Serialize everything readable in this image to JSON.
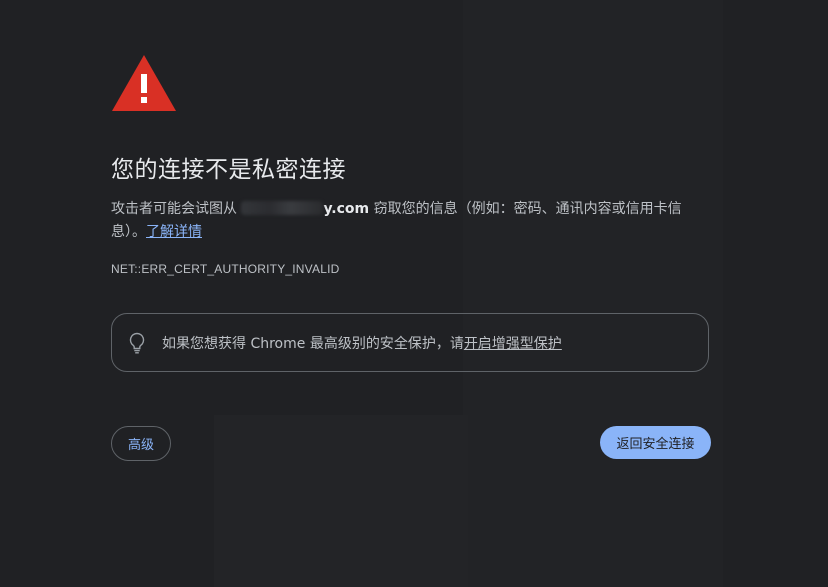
{
  "page": {
    "background": "#202124"
  },
  "interstitial": {
    "icon": "warning-triangle-icon",
    "icon_color": "#d93025",
    "title": "您的连接不是私密连接",
    "description_prefix": "攻击者可能会试图从",
    "domain_suffix": "y.com",
    "description_suffix": " 窃取您的信息（例如：密码、通讯内容或信用卡信息）。",
    "learn_more_link": "了解详情",
    "error_code": "NET::ERR_CERT_AUTHORITY_INVALID"
  },
  "enhanced_protection": {
    "icon": "lightbulb-icon",
    "text": "如果您想获得 Chrome 最高级别的安全保护，请",
    "link": "开启增强型保护"
  },
  "buttons": {
    "advanced_label": "高级",
    "back_label": "返回安全连接",
    "accent": "#8ab4f8"
  }
}
